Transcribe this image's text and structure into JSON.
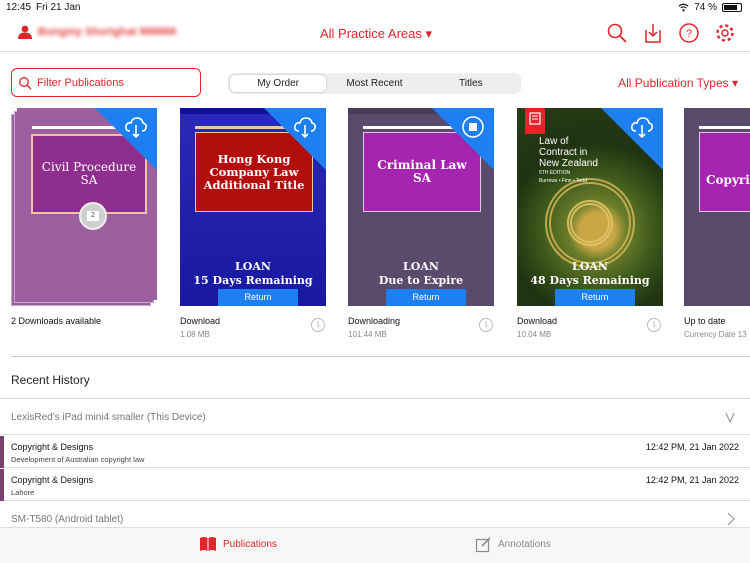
{
  "status_bar": {
    "time": "12:45",
    "date": "Fri 21 Jan",
    "battery": "74 %"
  },
  "header": {
    "user_name": "Bungmy Shorighat 888888",
    "practice_areas": "All Practice Areas ▾"
  },
  "toolbar": {
    "filter_placeholder": "Filter Publications",
    "segments": [
      "My Order",
      "Most Recent",
      "Titles"
    ],
    "publication_types": "All Publication Types ▾"
  },
  "books": [
    {
      "title": "Civil Procedure SA",
      "badge": "2",
      "status": "2 Downloads available",
      "size": "",
      "corner_icon": "cloud-download-icon"
    },
    {
      "title": "Hong Kong Company Law Additional Title",
      "loan_line1": "LOAN",
      "loan_line2": "15 Days Remaining",
      "return_label": "Return",
      "status": "Download",
      "size": "1.08 MB",
      "corner_icon": "cloud-download-icon"
    },
    {
      "title": "Criminal Law SA",
      "loan_line1": "LOAN",
      "loan_line2": "Due to Expire",
      "return_label": "Return",
      "status": "Downloading",
      "size": "101.44 MB",
      "corner_icon": "stop-download-icon"
    },
    {
      "title": "Law of Contract in New Zealand",
      "edition": "5TH EDITION",
      "authors": "Burrows • Finn • Todd",
      "loan_line1": "LOAN",
      "loan_line2": "48 Days Remaining",
      "return_label": "Return",
      "status": "Download",
      "size": "10.04 MB",
      "corner_icon": "cloud-download-icon"
    },
    {
      "title": "Copyrig",
      "status": "Up to date",
      "size": "Currency Date 13"
    }
  ],
  "recent_history": {
    "title": "Recent History",
    "device1": "LexisRed's iPad mini4 smaller (This Device)",
    "items": [
      {
        "title": "Copyright & Designs",
        "subtitle": "Development of Australian copyright law",
        "date": "12:42 PM, 21 Jan 2022"
      },
      {
        "title": "Copyright & Designs",
        "subtitle": "Lahore",
        "date": "12:42 PM, 21 Jan 2022"
      }
    ],
    "device2": "SM-T580 (Android tablet)"
  },
  "tabs": {
    "publications": "Publications",
    "annotations": "Annotations"
  },
  "colors": {
    "accent": "#e0262b",
    "blue": "#1e7ff0",
    "history_bar": "#7b3f6e"
  }
}
